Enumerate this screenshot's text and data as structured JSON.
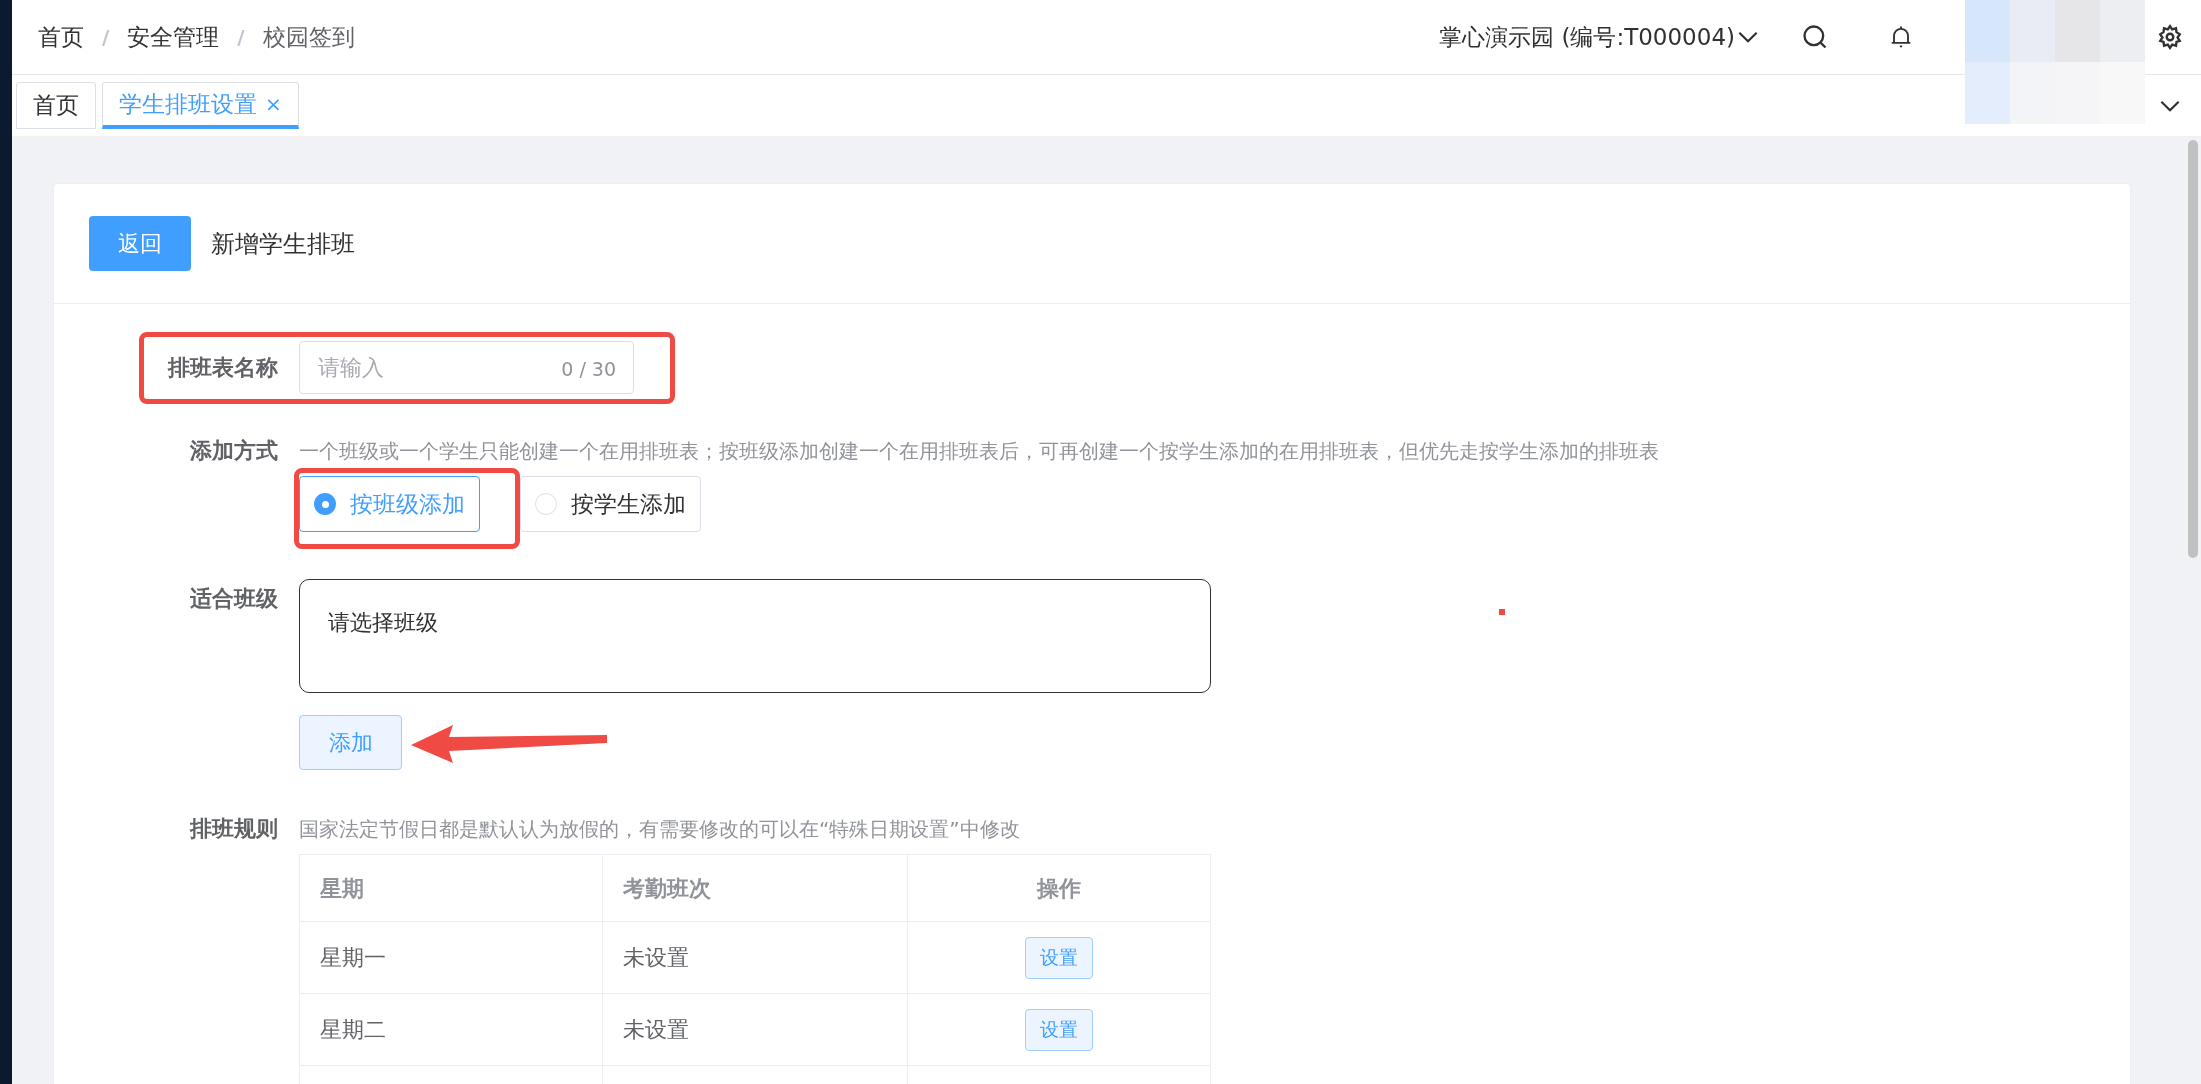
{
  "breadcrumb": {
    "separator": "/",
    "items": [
      "首页",
      "安全管理",
      "校园签到"
    ]
  },
  "header": {
    "school": "掌心演示园 (编号:T000004)"
  },
  "tabs": [
    {
      "label": "首页",
      "selected": false
    },
    {
      "label": "学生排班设置",
      "selected": true,
      "close": "×"
    }
  ],
  "page": {
    "back_button": "返回",
    "title": "新增学生排班"
  },
  "form": {
    "name": {
      "label": "排班表名称",
      "placeholder": "请输入",
      "counter": "0 / 30"
    },
    "mode": {
      "label": "添加方式",
      "hint": "一个班级或一个学生只能创建一个在用排班表；按班级添加创建一个在用排班表后，可再创建一个按学生添加的在用排班表，但优先走按学生添加的排班表",
      "options": [
        {
          "label": "按班级添加",
          "selected": true
        },
        {
          "label": "按学生添加",
          "selected": false
        }
      ]
    },
    "classes": {
      "label": "适合班级",
      "text": "请选择班级",
      "add_button": "添加"
    },
    "rules": {
      "label": "排班规则",
      "hint": "国家法定节假日都是默认认为放假的，有需要修改的可以在“特殊日期设置”中修改",
      "columns": [
        "星期",
        "考勤班次",
        "操作"
      ],
      "rows": [
        {
          "day": "星期一",
          "shift": "未设置",
          "action": "设置"
        },
        {
          "day": "星期二",
          "shift": "未设置",
          "action": "设置"
        }
      ]
    }
  }
}
